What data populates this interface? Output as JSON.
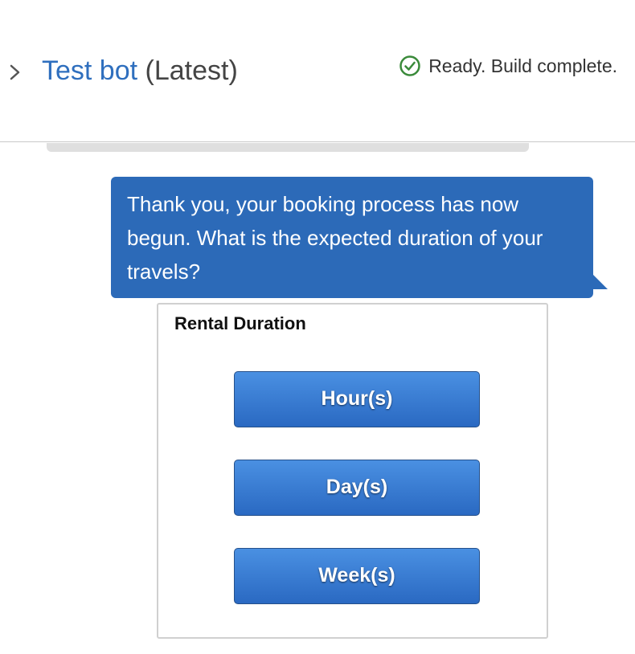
{
  "header": {
    "bot_name": "Test bot",
    "version": "(Latest)",
    "status_text": "Ready. Build complete.",
    "status_color": "#3a8a3a",
    "expand_icon": "chevron-right-icon",
    "status_icon": "check-circle-icon"
  },
  "chat": {
    "bot_message": "Thank you, your booking process has now begun. What is the expected duration of your travels?",
    "bubble_color": "#2c6ab8"
  },
  "response_card": {
    "title": "Rental Duration",
    "buttons": [
      {
        "label": "Hour(s)"
      },
      {
        "label": "Day(s)"
      },
      {
        "label": "Week(s)"
      }
    ]
  },
  "colors": {
    "link": "#2f6fbe",
    "button": "#3a7bd5"
  }
}
